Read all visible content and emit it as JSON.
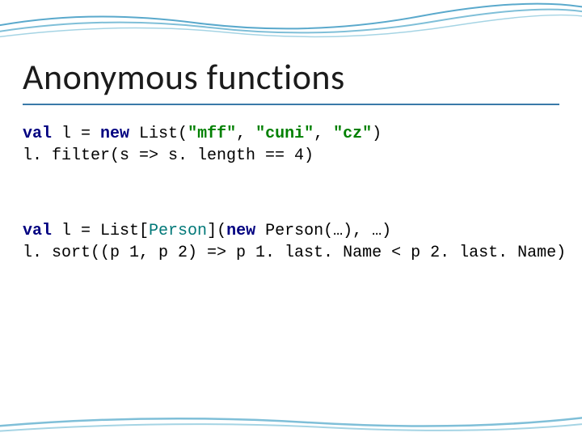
{
  "title": "Anonymous functions",
  "code1": {
    "line1_pre": "val",
    "line1_mid": " l = ",
    "line1_new": "new",
    "line1_rest": " List(",
    "line1_s1": "\"mff\"",
    "line1_c1": ", ",
    "line1_s2": "\"cuni\"",
    "line1_c2": ", ",
    "line1_s3": "\"cz\"",
    "line1_end": ")",
    "line2": "l. filter(s => s. length == 4)"
  },
  "code2": {
    "line1_pre": "val",
    "line1_mid": " l = List[",
    "line1_type": "Person",
    "line1_after": "](",
    "line1_new": "new",
    "line1_rest": " Person(…), …)",
    "line2": "l. sort((p 1, p 2) => p 1. last. Name < p 2. last. Name)"
  }
}
